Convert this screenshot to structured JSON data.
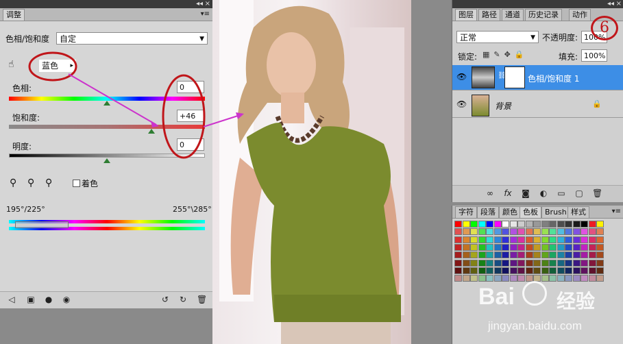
{
  "adjustments": {
    "tab": "调整",
    "preset_label": "色相/饱和度",
    "preset_value": "自定",
    "channel": "蓝色",
    "hue_label": "色相:",
    "hue_value": "0",
    "saturation_label": "饱和度:",
    "saturation_value": "+46",
    "lightness_label": "明度:",
    "lightness_value": "0",
    "colorize_label": "着色",
    "range_left": "195°/225°",
    "range_right": "255°\\285°"
  },
  "layers_panel": {
    "tabs": [
      "图层",
      "路径",
      "通道",
      "历史记录",
      "动作"
    ],
    "blend_mode": "正常",
    "opacity_label": "不透明度:",
    "opacity_value": "100%",
    "lock_label": "锁定:",
    "fill_label": "填充:",
    "fill_value": "100%",
    "layer1_name": "色相/饱和度 1",
    "layer2_name": "背景"
  },
  "swatches_panel": {
    "tabs": [
      "字符",
      "段落",
      "颜色",
      "色板",
      "Brush",
      "样式"
    ]
  },
  "annotation": {
    "step_number": "6"
  },
  "watermark": {
    "brand": "Bai",
    "brand_cn": "经验",
    "url": "jingyan.baidu.com"
  },
  "colors": {
    "accent_red": "#c0161a",
    "arrow_magenta": "#cc33cc",
    "selected_layer": "#3d8ee6"
  }
}
